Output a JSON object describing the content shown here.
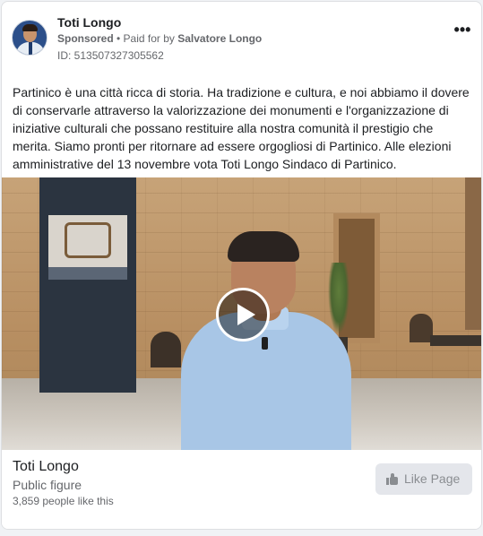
{
  "ad": {
    "page_name": "Toti Longo",
    "sponsored_label": "Sponsored",
    "separator": " • ",
    "paid_for_prefix": "Paid for by ",
    "paid_for_by": "Salvatore Longo",
    "ad_id": "ID: 513507327305562",
    "more_options_icon": "more-horizontal-icon",
    "more_options_glyph": "•••",
    "body_text": "Partinico è una città ricca di storia. Ha tradizione e cultura, e noi abbiamo il dovere di conservarle attraverso la valorizzazione dei monumenti e l'organizzazione di iniziative culturali che possano restituire alla nostra comunità il prestigio che merita. Siamo pronti per ritornare ad essere orgogliosi di Partinico. Alle elezioni amministrative del 13 novembre vota Toti Longo Sindaco di Partinico."
  },
  "media": {
    "type": "video",
    "play_icon": "play-icon"
  },
  "footer": {
    "page_name": "Toti Longo",
    "category": "Public figure",
    "likes": "3,859 people like this",
    "like_button_label": "Like Page",
    "like_icon": "thumbs-up-icon"
  },
  "colors": {
    "text_primary": "#1c1e21",
    "text_secondary": "#65676b",
    "button_bg": "#e4e6eb",
    "button_text": "#8a8d91"
  }
}
